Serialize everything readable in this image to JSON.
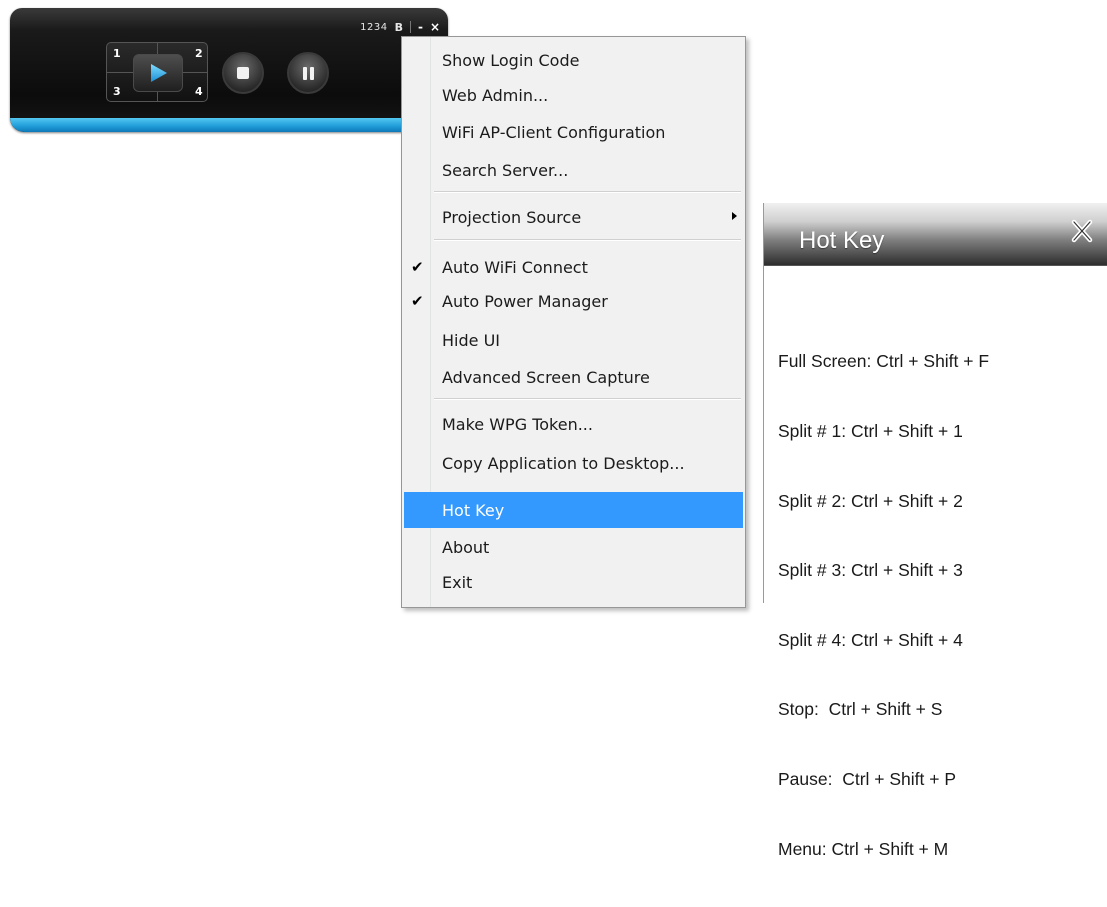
{
  "player": {
    "login_code": "1234",
    "code_icon": "b-icon",
    "minimize_label": "-",
    "close_label": "×",
    "split_labels": [
      "1",
      "2",
      "3",
      "4"
    ],
    "colors": {
      "accent": "#1f9bd8",
      "body": "#0c0c0c"
    }
  },
  "menu": {
    "items": [
      {
        "label": "Show Login Code",
        "checked": false,
        "submenu": false,
        "highlighted": false
      },
      {
        "label": "Web Admin...",
        "checked": false,
        "submenu": false,
        "highlighted": false
      },
      {
        "label": "WiFi AP-Client Configuration",
        "checked": false,
        "submenu": false,
        "highlighted": false
      },
      {
        "label": "Search Server...",
        "checked": false,
        "submenu": false,
        "highlighted": false
      },
      {
        "label": "Projection Source",
        "checked": false,
        "submenu": true,
        "highlighted": false
      },
      {
        "label": "Auto WiFi Connect",
        "checked": true,
        "submenu": false,
        "highlighted": false
      },
      {
        "label": "Auto Power Manager",
        "checked": true,
        "submenu": false,
        "highlighted": false
      },
      {
        "label": "Hide UI",
        "checked": false,
        "submenu": false,
        "highlighted": false
      },
      {
        "label": "Advanced Screen Capture",
        "checked": false,
        "submenu": false,
        "highlighted": false
      },
      {
        "label": "Make WPG Token...",
        "checked": false,
        "submenu": false,
        "highlighted": false
      },
      {
        "label": "Copy Application to Desktop...",
        "checked": false,
        "submenu": false,
        "highlighted": false
      },
      {
        "label": "Hot Key",
        "checked": false,
        "submenu": false,
        "highlighted": true
      },
      {
        "label": "About",
        "checked": false,
        "submenu": false,
        "highlighted": false
      },
      {
        "label": "Exit",
        "checked": false,
        "submenu": false,
        "highlighted": false
      }
    ],
    "colors": {
      "highlight": "#3399ff",
      "background": "#f1f1f1"
    }
  },
  "hotkey": {
    "title": "Hot Key",
    "lines": [
      "Full Screen: Ctrl + Shift + F",
      "Split # 1: Ctrl + Shift + 1",
      "Split # 2: Ctrl + Shift + 2",
      "Split # 3: Ctrl + Shift + 3",
      "Split # 4: Ctrl + Shift + 4",
      "Stop:  Ctrl + Shift + S",
      "Pause:  Ctrl + Shift + P",
      "Menu: Ctrl + Shift + M"
    ]
  }
}
